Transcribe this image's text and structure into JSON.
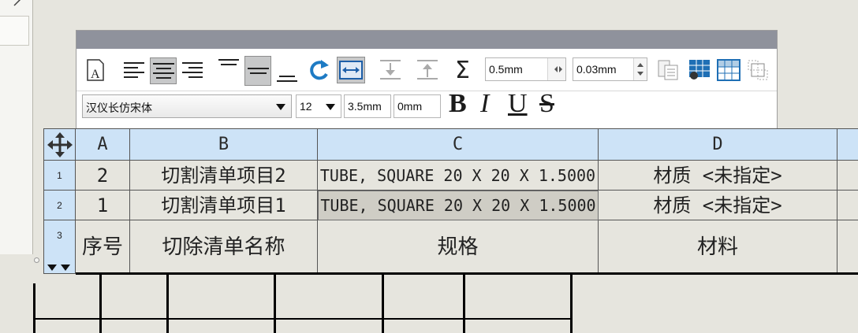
{
  "toolbar": {
    "stroke_width": "0.5mm",
    "line_gap": "0.03mm",
    "font_name": "汉仪长仿宋体",
    "font_size": "12",
    "text_height": "3.5mm",
    "spacing": "0mm",
    "bold": "B",
    "italic": "I",
    "underline": "U",
    "strike": "S",
    "icons": [
      "text-style-icon",
      "align-left-icon",
      "align-center-icon",
      "align-right-icon",
      "align-top-icon",
      "align-middle-icon",
      "align-bottom-icon",
      "rotate-icon",
      "fit-width-icon",
      "insert-row-below-icon",
      "insert-row-above-icon",
      "sum-icon",
      "table-properties-icon",
      "table-format-icon",
      "table-grid-icon",
      "merge-cells-icon"
    ]
  },
  "table": {
    "corner": "move-table-icon",
    "columns": [
      "A",
      "B",
      "C",
      "D",
      ""
    ],
    "rows": [
      {
        "num": "1",
        "a": "2",
        "b": "切割清单项目2",
        "c": "TUBE, SQUARE 20 X 20 X 1.5000",
        "d": "材质 <未指定>"
      },
      {
        "num": "2",
        "a": "1",
        "b": "切割清单项目1",
        "c": "TUBE, SQUARE 20 X 20 X 1.5000",
        "d": "材质 <未指定>"
      },
      {
        "num": "3",
        "a": "序号",
        "b": "切除清单名称",
        "c": "规格",
        "d": "材料"
      }
    ]
  },
  "colors": {
    "header_bg": "#cde3f7",
    "canvas_bg": "#e6e5de",
    "toolbar_title": "#8f929c"
  }
}
